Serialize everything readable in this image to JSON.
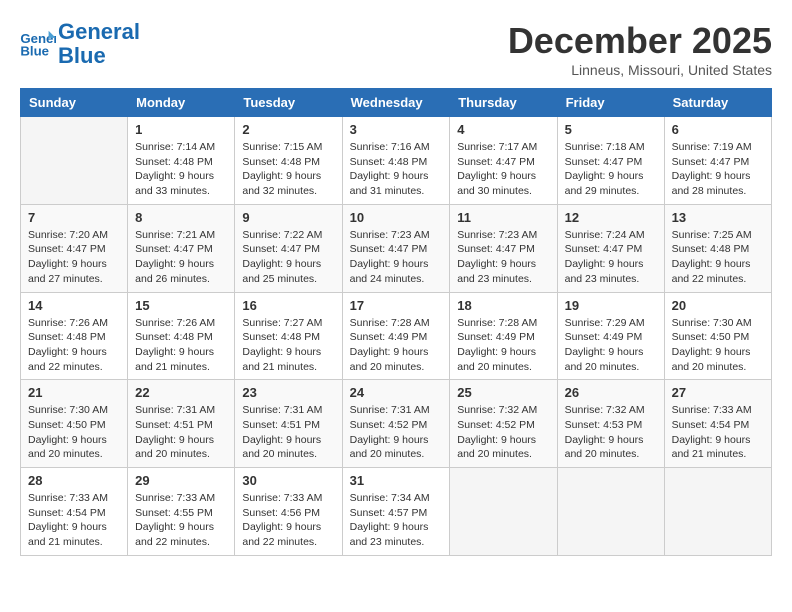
{
  "header": {
    "logo_line1": "General",
    "logo_line2": "Blue",
    "month": "December 2025",
    "location": "Linneus, Missouri, United States"
  },
  "weekdays": [
    "Sunday",
    "Monday",
    "Tuesday",
    "Wednesday",
    "Thursday",
    "Friday",
    "Saturday"
  ],
  "weeks": [
    [
      {
        "day": "",
        "sunrise": "",
        "sunset": "",
        "daylight": ""
      },
      {
        "day": "1",
        "sunrise": "Sunrise: 7:14 AM",
        "sunset": "Sunset: 4:48 PM",
        "daylight": "Daylight: 9 hours and 33 minutes."
      },
      {
        "day": "2",
        "sunrise": "Sunrise: 7:15 AM",
        "sunset": "Sunset: 4:48 PM",
        "daylight": "Daylight: 9 hours and 32 minutes."
      },
      {
        "day": "3",
        "sunrise": "Sunrise: 7:16 AM",
        "sunset": "Sunset: 4:48 PM",
        "daylight": "Daylight: 9 hours and 31 minutes."
      },
      {
        "day": "4",
        "sunrise": "Sunrise: 7:17 AM",
        "sunset": "Sunset: 4:47 PM",
        "daylight": "Daylight: 9 hours and 30 minutes."
      },
      {
        "day": "5",
        "sunrise": "Sunrise: 7:18 AM",
        "sunset": "Sunset: 4:47 PM",
        "daylight": "Daylight: 9 hours and 29 minutes."
      },
      {
        "day": "6",
        "sunrise": "Sunrise: 7:19 AM",
        "sunset": "Sunset: 4:47 PM",
        "daylight": "Daylight: 9 hours and 28 minutes."
      }
    ],
    [
      {
        "day": "7",
        "sunrise": "Sunrise: 7:20 AM",
        "sunset": "Sunset: 4:47 PM",
        "daylight": "Daylight: 9 hours and 27 minutes."
      },
      {
        "day": "8",
        "sunrise": "Sunrise: 7:21 AM",
        "sunset": "Sunset: 4:47 PM",
        "daylight": "Daylight: 9 hours and 26 minutes."
      },
      {
        "day": "9",
        "sunrise": "Sunrise: 7:22 AM",
        "sunset": "Sunset: 4:47 PM",
        "daylight": "Daylight: 9 hours and 25 minutes."
      },
      {
        "day": "10",
        "sunrise": "Sunrise: 7:23 AM",
        "sunset": "Sunset: 4:47 PM",
        "daylight": "Daylight: 9 hours and 24 minutes."
      },
      {
        "day": "11",
        "sunrise": "Sunrise: 7:23 AM",
        "sunset": "Sunset: 4:47 PM",
        "daylight": "Daylight: 9 hours and 23 minutes."
      },
      {
        "day": "12",
        "sunrise": "Sunrise: 7:24 AM",
        "sunset": "Sunset: 4:47 PM",
        "daylight": "Daylight: 9 hours and 23 minutes."
      },
      {
        "day": "13",
        "sunrise": "Sunrise: 7:25 AM",
        "sunset": "Sunset: 4:48 PM",
        "daylight": "Daylight: 9 hours and 22 minutes."
      }
    ],
    [
      {
        "day": "14",
        "sunrise": "Sunrise: 7:26 AM",
        "sunset": "Sunset: 4:48 PM",
        "daylight": "Daylight: 9 hours and 22 minutes."
      },
      {
        "day": "15",
        "sunrise": "Sunrise: 7:26 AM",
        "sunset": "Sunset: 4:48 PM",
        "daylight": "Daylight: 9 hours and 21 minutes."
      },
      {
        "day": "16",
        "sunrise": "Sunrise: 7:27 AM",
        "sunset": "Sunset: 4:48 PM",
        "daylight": "Daylight: 9 hours and 21 minutes."
      },
      {
        "day": "17",
        "sunrise": "Sunrise: 7:28 AM",
        "sunset": "Sunset: 4:49 PM",
        "daylight": "Daylight: 9 hours and 20 minutes."
      },
      {
        "day": "18",
        "sunrise": "Sunrise: 7:28 AM",
        "sunset": "Sunset: 4:49 PM",
        "daylight": "Daylight: 9 hours and 20 minutes."
      },
      {
        "day": "19",
        "sunrise": "Sunrise: 7:29 AM",
        "sunset": "Sunset: 4:49 PM",
        "daylight": "Daylight: 9 hours and 20 minutes."
      },
      {
        "day": "20",
        "sunrise": "Sunrise: 7:30 AM",
        "sunset": "Sunset: 4:50 PM",
        "daylight": "Daylight: 9 hours and 20 minutes."
      }
    ],
    [
      {
        "day": "21",
        "sunrise": "Sunrise: 7:30 AM",
        "sunset": "Sunset: 4:50 PM",
        "daylight": "Daylight: 9 hours and 20 minutes."
      },
      {
        "day": "22",
        "sunrise": "Sunrise: 7:31 AM",
        "sunset": "Sunset: 4:51 PM",
        "daylight": "Daylight: 9 hours and 20 minutes."
      },
      {
        "day": "23",
        "sunrise": "Sunrise: 7:31 AM",
        "sunset": "Sunset: 4:51 PM",
        "daylight": "Daylight: 9 hours and 20 minutes."
      },
      {
        "day": "24",
        "sunrise": "Sunrise: 7:31 AM",
        "sunset": "Sunset: 4:52 PM",
        "daylight": "Daylight: 9 hours and 20 minutes."
      },
      {
        "day": "25",
        "sunrise": "Sunrise: 7:32 AM",
        "sunset": "Sunset: 4:52 PM",
        "daylight": "Daylight: 9 hours and 20 minutes."
      },
      {
        "day": "26",
        "sunrise": "Sunrise: 7:32 AM",
        "sunset": "Sunset: 4:53 PM",
        "daylight": "Daylight: 9 hours and 20 minutes."
      },
      {
        "day": "27",
        "sunrise": "Sunrise: 7:33 AM",
        "sunset": "Sunset: 4:54 PM",
        "daylight": "Daylight: 9 hours and 21 minutes."
      }
    ],
    [
      {
        "day": "28",
        "sunrise": "Sunrise: 7:33 AM",
        "sunset": "Sunset: 4:54 PM",
        "daylight": "Daylight: 9 hours and 21 minutes."
      },
      {
        "day": "29",
        "sunrise": "Sunrise: 7:33 AM",
        "sunset": "Sunset: 4:55 PM",
        "daylight": "Daylight: 9 hours and 22 minutes."
      },
      {
        "day": "30",
        "sunrise": "Sunrise: 7:33 AM",
        "sunset": "Sunset: 4:56 PM",
        "daylight": "Daylight: 9 hours and 22 minutes."
      },
      {
        "day": "31",
        "sunrise": "Sunrise: 7:34 AM",
        "sunset": "Sunset: 4:57 PM",
        "daylight": "Daylight: 9 hours and 23 minutes."
      },
      {
        "day": "",
        "sunrise": "",
        "sunset": "",
        "daylight": ""
      },
      {
        "day": "",
        "sunrise": "",
        "sunset": "",
        "daylight": ""
      },
      {
        "day": "",
        "sunrise": "",
        "sunset": "",
        "daylight": ""
      }
    ]
  ]
}
